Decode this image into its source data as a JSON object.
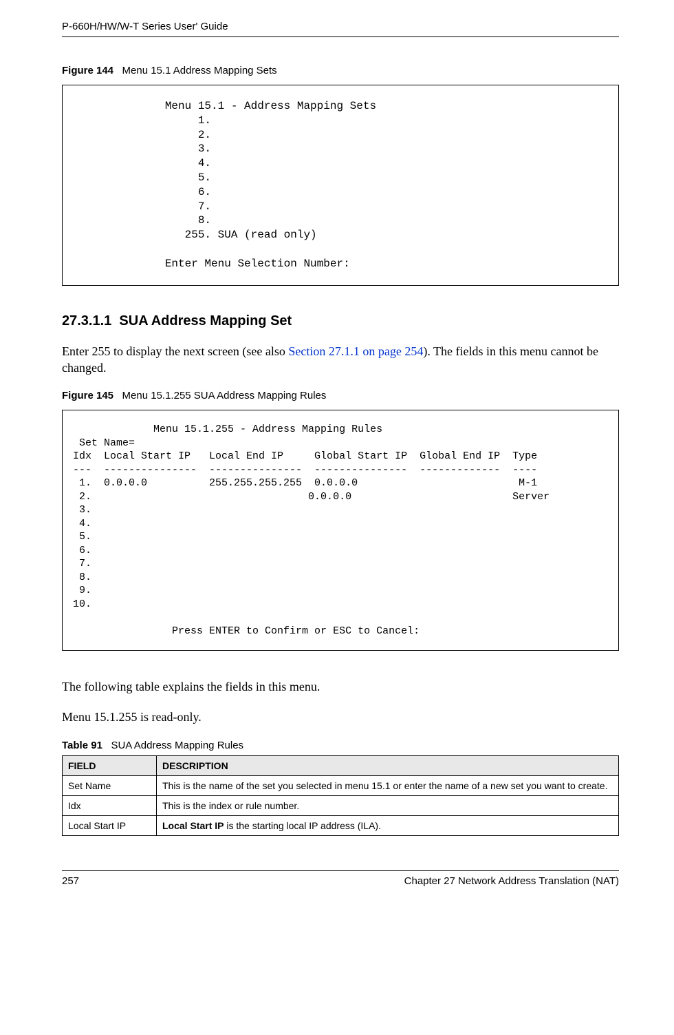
{
  "header": {
    "title": "P-660H/HW/W-T Series User' Guide"
  },
  "figure144": {
    "label": "Figure 144",
    "caption": "Menu 15.1 Address Mapping Sets",
    "code": "             Menu 15.1 - Address Mapping Sets\n                  1.\n                  2.\n                  3.\n                  4.\n                  5.\n                  6.\n                  7.\n                  8.\n                255. SUA (read only)\n\n             Enter Menu Selection Number:"
  },
  "section": {
    "number": "27.3.1.1",
    "title": "SUA Address Mapping Set",
    "para_prefix": "Enter 255 to display the next screen (see also ",
    "para_link": "Section 27.1.1 on page 254",
    "para_suffix": "). The fields in this menu cannot be changed."
  },
  "figure145": {
    "label": "Figure 145",
    "caption": "Menu 15.1.255 SUA Address Mapping Rules",
    "code": "              Menu 15.1.255 - Address Mapping Rules\n  Set Name= \n Idx  Local Start IP   Local End IP     Global Start IP  Global End IP  Type\n ---  ---------------  ---------------  ---------------  -------------  ----\n  1.  0.0.0.0          255.255.255.255  0.0.0.0                          M-1\n  2.                                   0.0.0.0                          Server\n  3.\n  4.\n  5.\n  6.\n  7.\n  8.\n  9.\n 10.\n\n                 Press ENTER to Confirm or ESC to Cancel:"
  },
  "after_code": {
    "p1": "The following table explains the fields in this menu.",
    "p2": "Menu 15.1.255 is read-only."
  },
  "table91": {
    "label": "Table 91",
    "caption": "SUA Address Mapping Rules",
    "head_field": "FIELD",
    "head_desc": "DESCRIPTION",
    "rows": [
      {
        "field": "Set Name",
        "desc": "This is the name of the set you selected in menu 15.1 or enter the name of a new set you want to create."
      },
      {
        "field": "Idx",
        "desc": "This is the index or rule number."
      },
      {
        "field": "Local Start IP",
        "desc_prefix_bold": "Local Start IP",
        "desc_rest": " is the starting local IP address (ILA)."
      }
    ]
  },
  "footer": {
    "page": "257",
    "chapter": "Chapter 27 Network Address Translation (NAT)"
  }
}
